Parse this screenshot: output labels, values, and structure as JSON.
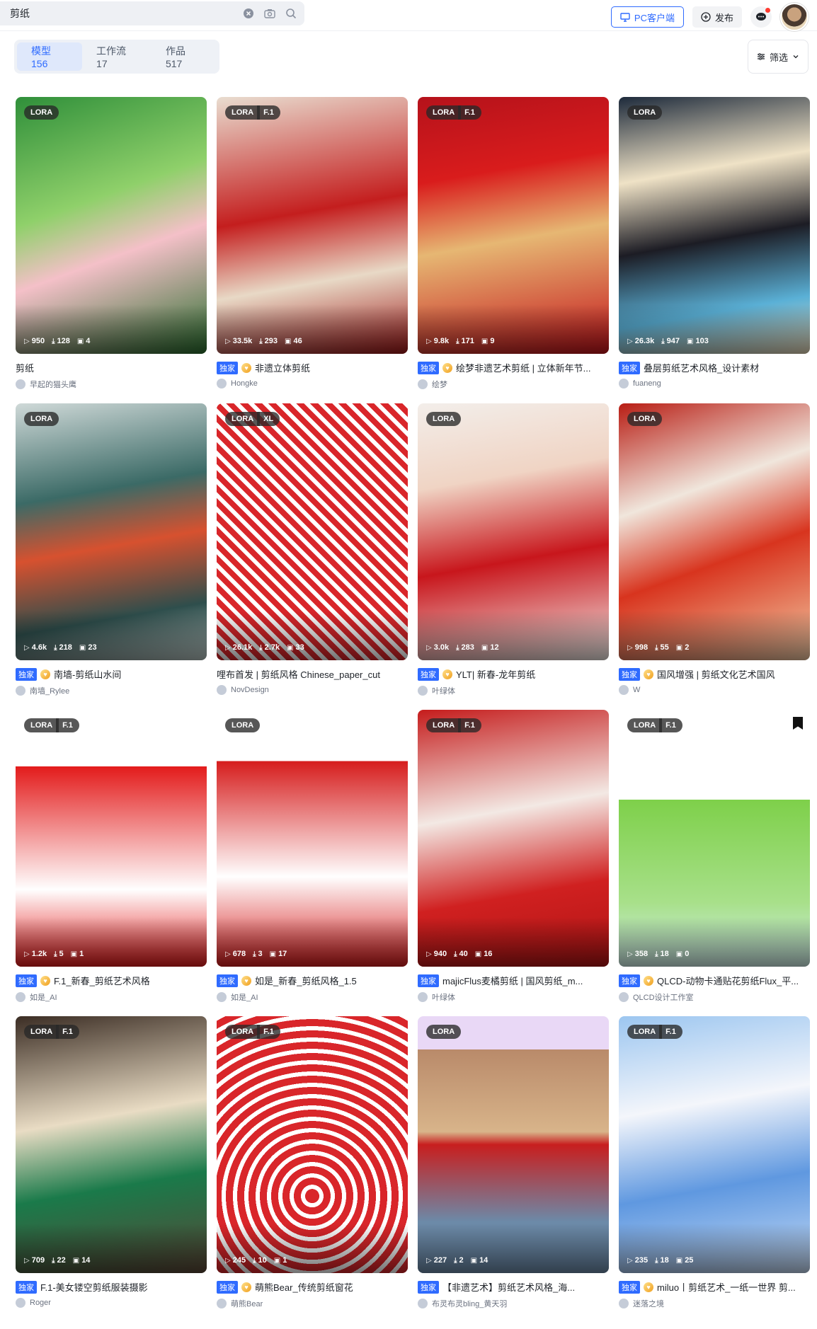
{
  "search": {
    "value": "剪纸"
  },
  "header": {
    "pc_client_label": "PC客户端",
    "publish_label": "发布"
  },
  "tabs": [
    {
      "label": "模型 156",
      "active": true
    },
    {
      "label": "工作流 17",
      "active": false
    },
    {
      "label": "作品 517",
      "active": false
    }
  ],
  "filter": {
    "label": "筛选"
  },
  "colors": {
    "accent": "#2f6bff",
    "exclusive_badge": "#2f6bff"
  },
  "cards": [
    {
      "badges": [
        "LORA"
      ],
      "views": "950",
      "downloads": "128",
      "images": "4",
      "exclusive": false,
      "vip": false,
      "title": "剪纸",
      "author": "早起的猫头鹰",
      "thumb": "linear-gradient(160deg,#2f8f3a,#8fd06a 40%,#f4c0c8 60%,#2b6e2f)"
    },
    {
      "badges": [
        "LORA",
        "F.1"
      ],
      "views": "33.5k",
      "downloads": "293",
      "images": "46",
      "exclusive": true,
      "vip": true,
      "title": "非遗立体剪纸",
      "author": "Hongke",
      "thumb": "linear-gradient(170deg,#e9ddd0,#c41e1e 45%,#e8d9c6 70%,#9e1818)"
    },
    {
      "badges": [
        "LORA",
        "F.1"
      ],
      "views": "9.8k",
      "downloads": "171",
      "images": "9",
      "exclusive": true,
      "vip": true,
      "title": "绘梦非遗艺术剪纸 | 立体新年节...",
      "author": "绘梦",
      "thumb": "linear-gradient(170deg,#b5121b,#d91c1c 30%,#e6b773 55%,#c4141b)"
    },
    {
      "badges": [
        "LORA"
      ],
      "views": "26.3k",
      "downloads": "947",
      "images": "103",
      "exclusive": true,
      "vip": false,
      "title": "叠层剪纸艺术风格_设计素材",
      "author": "fuaneng",
      "thumb": "linear-gradient(170deg,#1d2a3b,#efe2c6 30%,#1c1c24 55%,#5ab0d6 80%,#e9d9b8)"
    },
    {
      "badges": [
        "LORA"
      ],
      "views": "4.6k",
      "downloads": "218",
      "images": "23",
      "exclusive": true,
      "vip": true,
      "title": "南墙-剪纸山水间",
      "author": "南墙_Rylee",
      "thumb": "linear-gradient(170deg,#cfd9d8,#3b6a66 35%,#d7512f 55%,#2e4e4c 80%,#b9c7c4)"
    },
    {
      "badges": [
        "LORA",
        "XL"
      ],
      "views": "26.1k",
      "downloads": "2.7k",
      "images": "33",
      "exclusive": false,
      "vip": false,
      "title": "哩布首发 | 剪纸风格 Chinese_paper_cut",
      "author": "NovDesign",
      "thumb": "repeating-linear-gradient(45deg,#d9262a 0 8px,#fff 8px 14px)"
    },
    {
      "badges": [
        "LORA"
      ],
      "views": "3.0k",
      "downloads": "283",
      "images": "12",
      "exclusive": true,
      "vip": true,
      "title": "YLT| 新春-龙年剪纸",
      "author": "叶绿体",
      "thumb": "linear-gradient(170deg,#f3eeea,#f0d4c4 30%,#c8161c 60%,#f2ece8)"
    },
    {
      "badges": [
        "LORA"
      ],
      "views": "998",
      "downloads": "55",
      "images": "2",
      "exclusive": true,
      "vip": true,
      "title": "国风增强 | 剪纸文化艺术国风",
      "author": "W",
      "thumb": "linear-gradient(160deg,#b81d14,#f0e6dc 35%,#d8341e 60%,#f2c9a3)"
    },
    {
      "badges": [
        "LORA",
        "F.1"
      ],
      "views": "1.2k",
      "downloads": "5",
      "images": "1",
      "exclusive": true,
      "vip": true,
      "title": "F.1_新春_剪纸艺术风格",
      "author": "如是_AI",
      "thumb": "linear-gradient(180deg,#fff 0 22%,#e31b1b 22%,#fff 70%,#e31b1b)"
    },
    {
      "badges": [
        "LORA"
      ],
      "views": "678",
      "downloads": "3",
      "images": "17",
      "exclusive": true,
      "vip": true,
      "title": "如是_新春_剪纸风格_1.5",
      "author": "如是_AI",
      "thumb": "linear-gradient(180deg,#fff 0 20%,#d61d1d 20%,#fff 65%,#d61d1d)"
    },
    {
      "badges": [
        "LORA",
        "F.1"
      ],
      "views": "940",
      "downloads": "40",
      "images": "16",
      "exclusive": true,
      "vip": false,
      "title": "majicFlus麦橘剪纸 | 国风剪纸_m...",
      "author": "叶绿体",
      "thumb": "linear-gradient(170deg,#c51c1c,#f3e9e4 40%,#d02020 70%,#b01515)"
    },
    {
      "badges": [
        "LORA",
        "F.1"
      ],
      "views": "358",
      "downloads": "18",
      "images": "0",
      "exclusive": true,
      "vip": true,
      "title": "QLCD-动物卡通贴花剪纸Flux_平...",
      "author": "QLCD设计工作室",
      "thumb": "linear-gradient(180deg,#fff 0 35%,#7ed04a 35%,#a8e08a 75%,#cfeee8)",
      "flag": true
    },
    {
      "badges": [
        "LORA",
        "F.1"
      ],
      "views": "709",
      "downloads": "22",
      "images": "14",
      "exclusive": true,
      "vip": false,
      "title": "F.1-美女镂空剪纸服装摄影",
      "author": "Roger",
      "thumb": "linear-gradient(170deg,#3b2d24,#e9dcc4 40%,#1a7a4a 65%,#5a4636)"
    },
    {
      "badges": [
        "LORA",
        "F.1"
      ],
      "views": "245",
      "downloads": "10",
      "images": "1",
      "exclusive": true,
      "vip": true,
      "title": "萌熊Bear_传统剪纸窗花",
      "author": "萌熊Bear",
      "thumb": "repeating-radial-gradient(circle at 50% 70%,#d9262a 0 10px,#fff 10px 16px)"
    },
    {
      "badges": [
        "LORA"
      ],
      "views": "227",
      "downloads": "2",
      "images": "14",
      "exclusive": true,
      "vip": false,
      "title": "【非遗艺术】剪纸艺术风格_海...",
      "author": "布灵布灵bling_黄天羽",
      "thumb": "linear-gradient(180deg,#e9d8f6 0 13%,#b98a6a 13%,#d8b48a 45%,#c81e1e 50%,#6c8aa8 80%)"
    },
    {
      "badges": [
        "LORA",
        "F.1"
      ],
      "views": "235",
      "downloads": "18",
      "images": "25",
      "exclusive": true,
      "vip": true,
      "title": "miluo丨剪纸艺术_一纸一世界 剪...",
      "author": "迷落之境",
      "thumb": "linear-gradient(170deg,#9cc6f0,#f4f6fb 35%,#5f98e0 65%,#c6dbf5)"
    }
  ]
}
